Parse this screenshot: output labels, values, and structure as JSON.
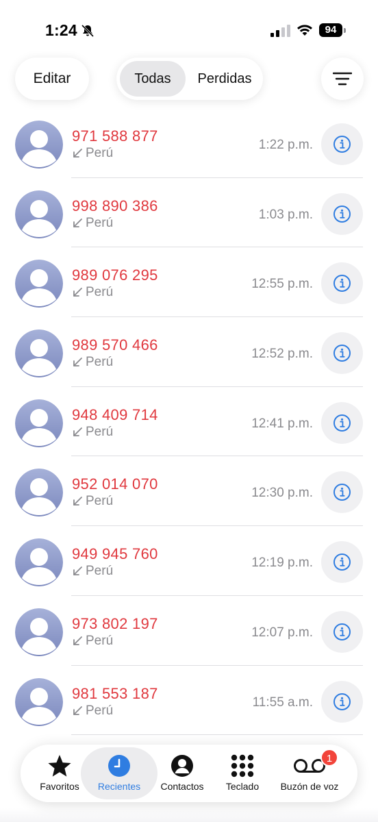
{
  "status_bar": {
    "time": "1:24",
    "battery": "94"
  },
  "header": {
    "edit_label": "Editar",
    "segments": [
      "Todas",
      "Perdidas"
    ],
    "selected_segment": "Todas"
  },
  "calls": [
    {
      "number": "971 588 877",
      "country": "Perú",
      "time": "1:22 p.m."
    },
    {
      "number": "998 890 386",
      "country": "Perú",
      "time": "1:03 p.m."
    },
    {
      "number": "989 076 295",
      "country": "Perú",
      "time": "12:55 p.m."
    },
    {
      "number": "989 570 466",
      "country": "Perú",
      "time": "12:52 p.m."
    },
    {
      "number": "948 409 714",
      "country": "Perú",
      "time": "12:41 p.m."
    },
    {
      "number": "952 014 070",
      "country": "Perú",
      "time": "12:30 p.m."
    },
    {
      "number": "949 945 760",
      "country": "Perú",
      "time": "12:19 p.m."
    },
    {
      "number": "973 802 197",
      "country": "Perú",
      "time": "12:07 p.m."
    },
    {
      "number": "981 553 187",
      "country": "Perú",
      "time": "11:55 a.m."
    }
  ],
  "tabs": [
    {
      "label": "Favoritos",
      "icon": "star-icon"
    },
    {
      "label": "Recientes",
      "icon": "clock-icon",
      "active": true
    },
    {
      "label": "Contactos",
      "icon": "person-circle-icon"
    },
    {
      "label": "Teclado",
      "icon": "keypad-icon"
    },
    {
      "label": "Buzón de voz",
      "icon": "voicemail-icon",
      "badge": "1"
    }
  ],
  "colors": {
    "missed_call": "#e0383e",
    "accent": "#2f7de1",
    "badge": "#f2443b"
  }
}
